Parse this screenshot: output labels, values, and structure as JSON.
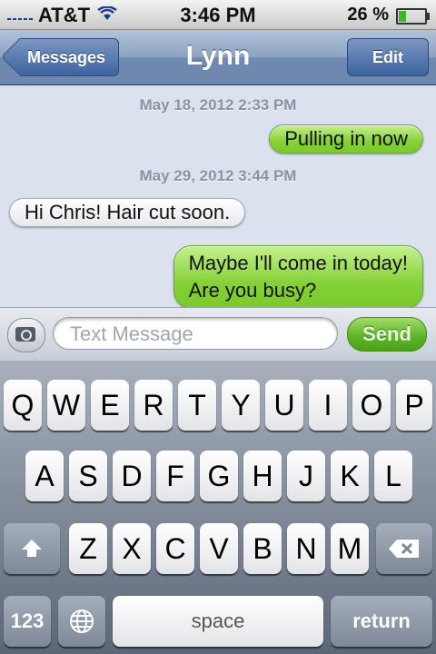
{
  "status_bar": {
    "carrier": "AT&T",
    "time": "3:46 PM",
    "battery_text": "26 %",
    "battery_level": 0.26
  },
  "nav": {
    "back_label": "Messages",
    "title": "Lynn",
    "edit_label": "Edit"
  },
  "conversation": {
    "timestamps": [
      "May 18, 2012 2:33 PM",
      "May 29, 2012 3:44 PM"
    ],
    "messages": [
      {
        "direction": "outgoing",
        "lines": [
          "Pulling in now"
        ]
      },
      {
        "direction": "incoming",
        "lines": [
          "Hi Chris! Hair cut soon."
        ]
      },
      {
        "direction": "outgoing",
        "lines": [
          "Maybe I'll come in today!",
          "Are you busy?"
        ]
      }
    ]
  },
  "input": {
    "placeholder": "Text Message",
    "send_label": "Send"
  },
  "keyboard": {
    "row1": [
      "Q",
      "W",
      "E",
      "R",
      "T",
      "Y",
      "U",
      "I",
      "O",
      "P"
    ],
    "row2": [
      "A",
      "S",
      "D",
      "F",
      "G",
      "H",
      "J",
      "K",
      "L"
    ],
    "row3": [
      "Z",
      "X",
      "C",
      "V",
      "B",
      "N",
      "M"
    ],
    "numbers_label": "123",
    "space_label": "space",
    "return_label": "return",
    "icons": {
      "shift": "shift-icon",
      "delete": "delete-icon",
      "globe": "globe-icon"
    }
  },
  "colors": {
    "outgoing_bubble": "#85d138",
    "incoming_bubble": "#ffffff",
    "nav_bar": "#6f8ab0",
    "send_button": "#5fb528"
  }
}
